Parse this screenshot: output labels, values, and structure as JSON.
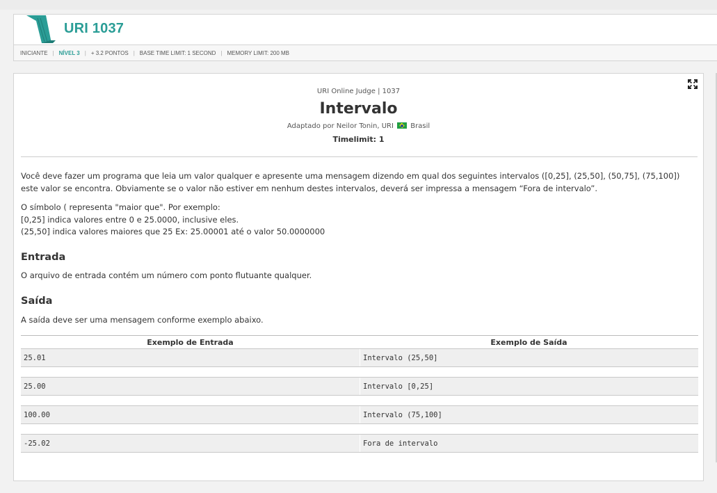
{
  "header": {
    "problem_code": "URI 1037",
    "meta": {
      "category": "INICIANTE",
      "level": "NÍVEL 3",
      "points": "+ 3.2 PONTOS",
      "time_limit": "BASE TIME LIMIT: 1 SECOND",
      "memory_limit": "MEMORY LIMIT: 200 MB"
    }
  },
  "problem": {
    "judge_line": "URI Online Judge | 1037",
    "title": "Intervalo",
    "author_prefix": "Adaptado por Neilor Tonin, URI",
    "author_country": "Brasil",
    "timelimit": "Timelimit: 1",
    "description_1": "Você deve fazer um programa que leia um valor qualquer e apresente uma mensagem dizendo em qual dos seguintes intervalos ([0,25], (25,50], (50,75], (75,100]) este valor se encontra. Obviamente se o valor não estiver em nenhum destes intervalos, deverá ser impressa a mensagem “Fora de intervalo”.",
    "description_2_line1": "O símbolo ( representa \"maior que\". Por exemplo:",
    "description_2_line2": "[0,25]  indica valores entre 0 e 25.0000, inclusive eles.",
    "description_2_line3": "(25,50] indica valores maiores que 25 Ex: 25.00001 até o valor 50.0000000",
    "input_heading": "Entrada",
    "input_text": "O arquivo de entrada contém um número com ponto flutuante qualquer.",
    "output_heading": "Saída",
    "output_text": "A saída deve ser uma mensagem conforme exemplo abaixo.",
    "samples": {
      "input_header": "Exemplo de Entrada",
      "output_header": "Exemplo de Saída",
      "rows": [
        {
          "input": "25.01",
          "output": "Intervalo (25,50]"
        },
        {
          "input": "25.00",
          "output": "Intervalo [0,25]"
        },
        {
          "input": "100.00",
          "output": "Intervalo (75,100]"
        },
        {
          "input": "-25.02",
          "output": "Fora de intervalo"
        }
      ]
    }
  },
  "colors": {
    "accent": "#2a9d96",
    "sample_row_bg": "#efefef"
  },
  "icons": {
    "logo": "uri-logo-icon",
    "expand": "fullscreen-expand-icon",
    "flag": "brazil-flag-icon"
  }
}
